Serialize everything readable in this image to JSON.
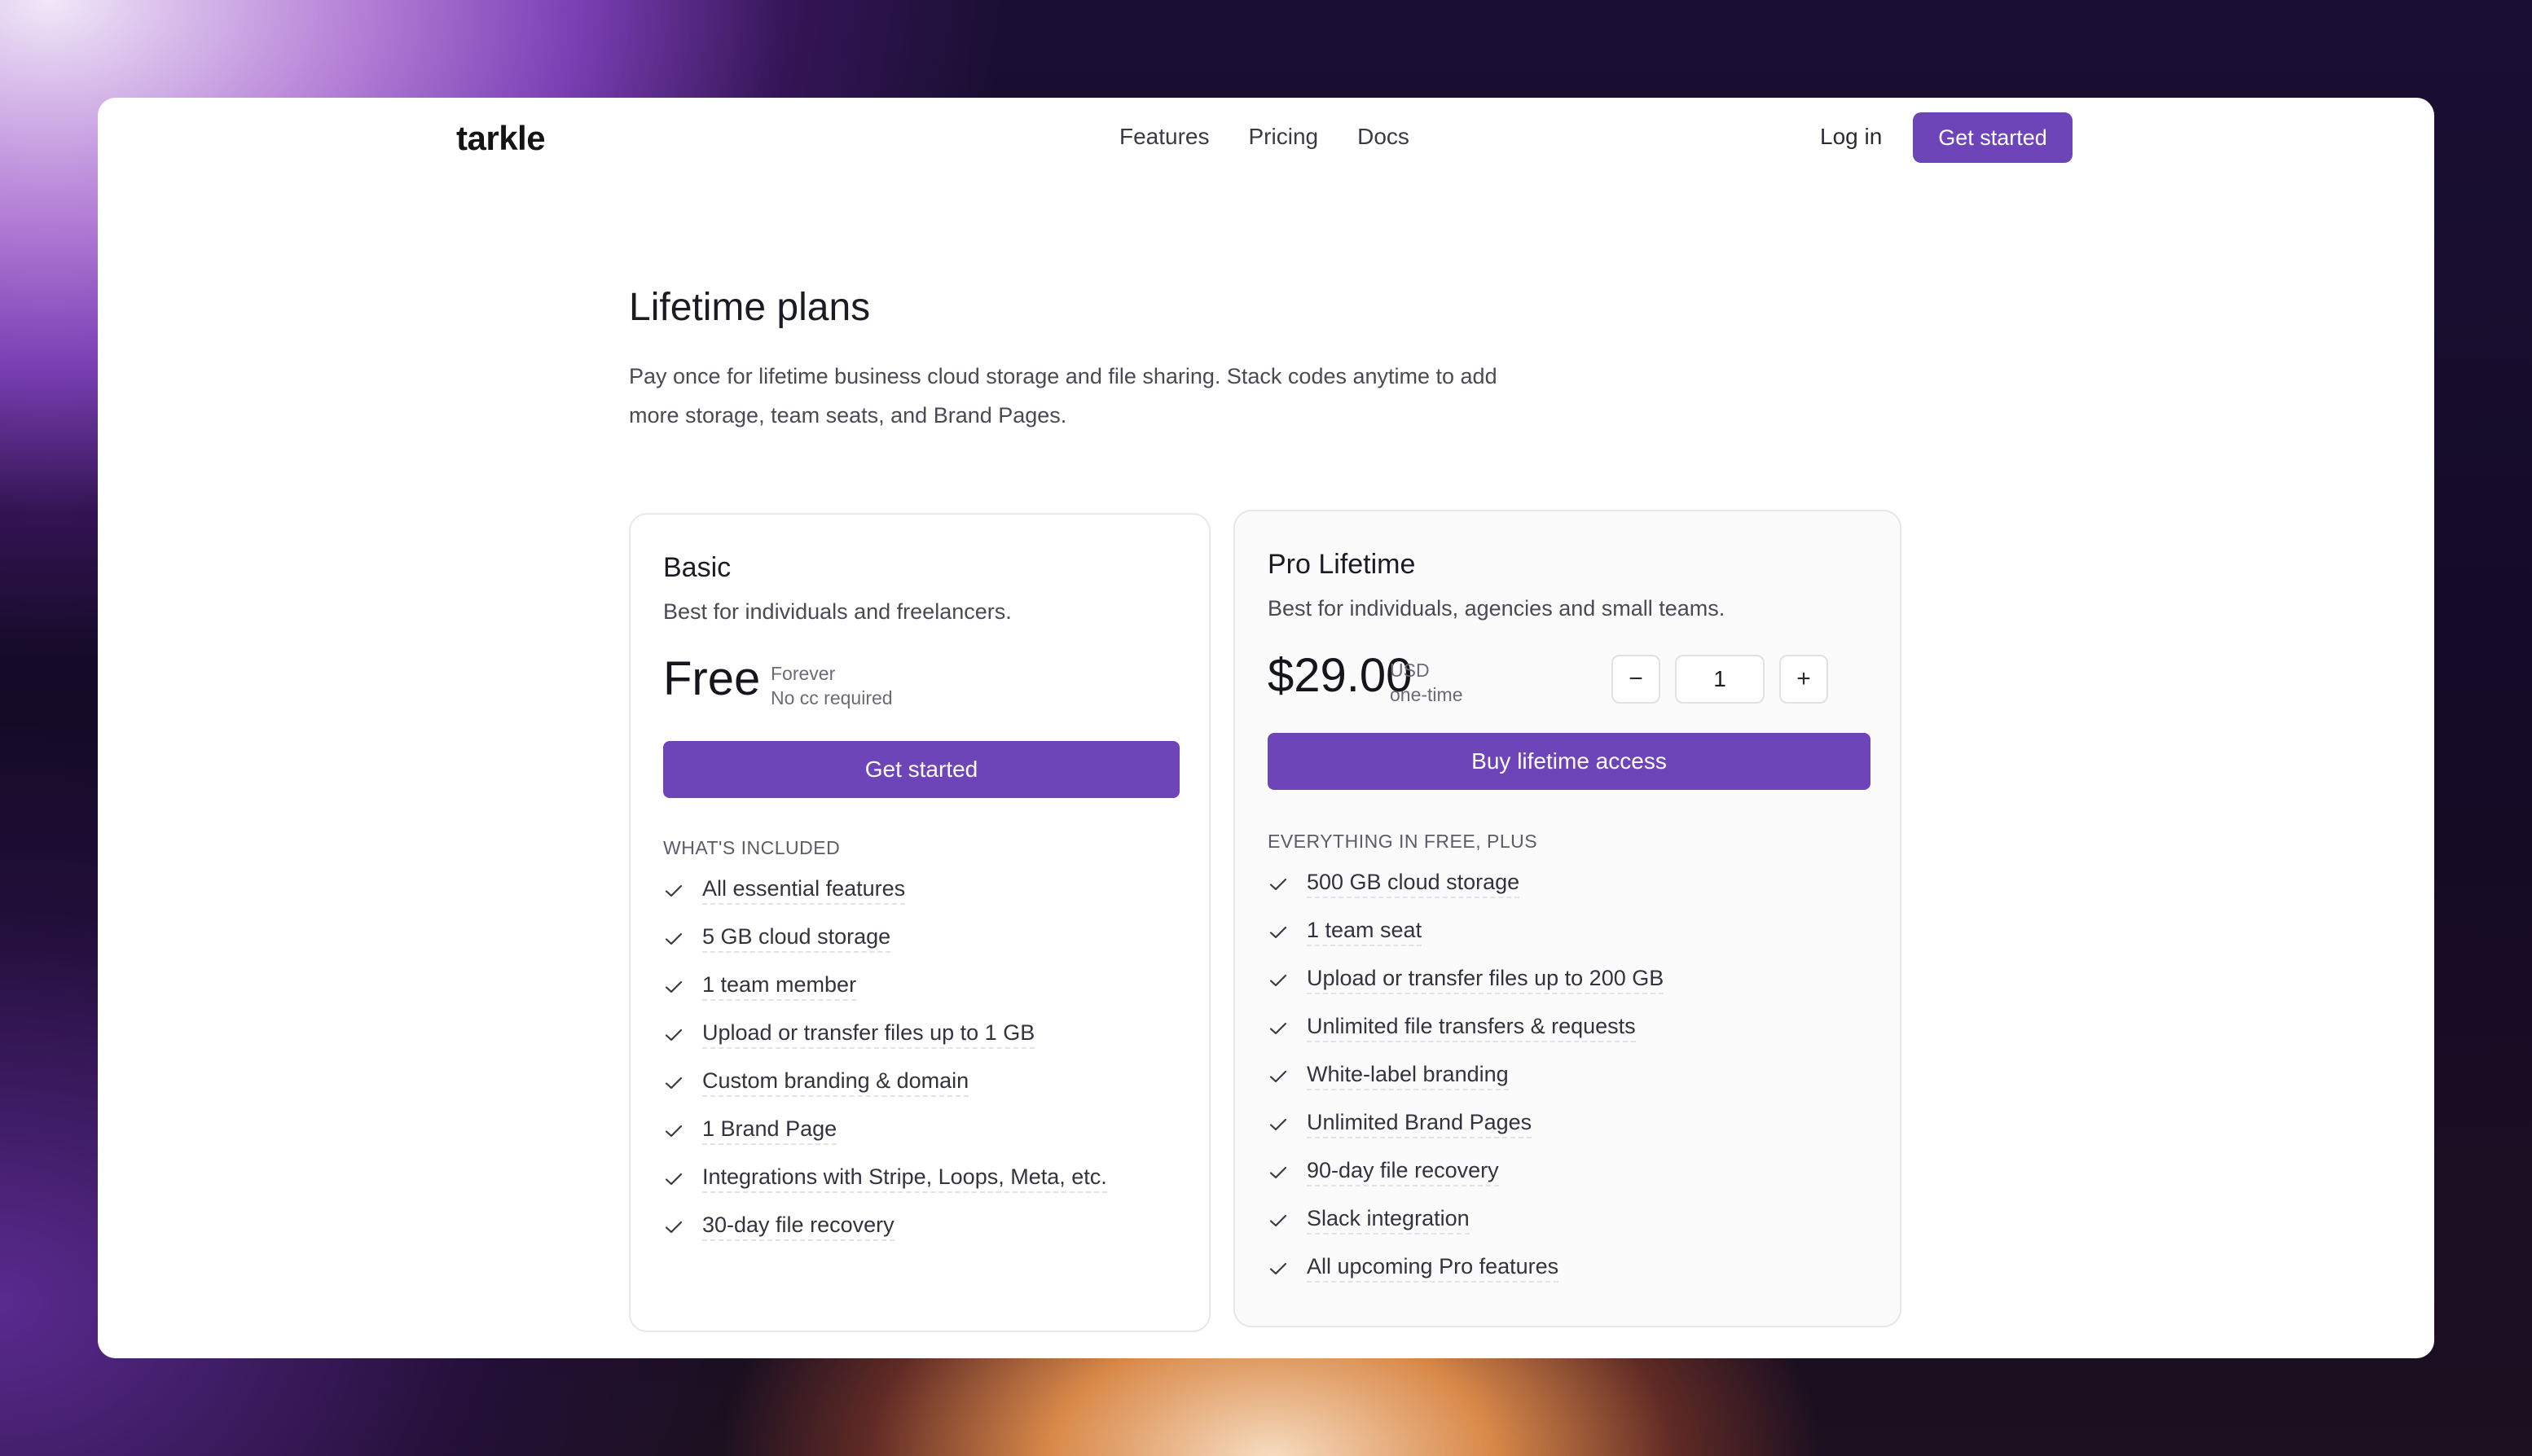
{
  "brand": {
    "name": "tarkle",
    "accent": "#6d45b8"
  },
  "nav": {
    "links": [
      "Features",
      "Pricing",
      "Docs"
    ],
    "login": "Log in",
    "cta": "Get started"
  },
  "hero": {
    "title": "Lifetime plans",
    "description": "Pay once for lifetime business cloud storage and file sharing. Stack codes anytime to add more storage, team seats, and Brand Pages."
  },
  "plans": {
    "basic": {
      "name": "Basic",
      "subtitle": "Best for individuals and freelancers.",
      "price": "Free",
      "meta_1": "Forever",
      "meta_2": "No cc required",
      "cta": "Get started",
      "section_label": "WHAT'S INCLUDED",
      "features": [
        "All essential features",
        "5 GB cloud storage",
        "1 team member",
        "Upload or transfer files up to 1 GB",
        "Custom branding & domain",
        "1 Brand Page",
        "Integrations with Stripe, Loops, Meta, etc.",
        "30-day file recovery"
      ]
    },
    "pro": {
      "name": "Pro Lifetime",
      "subtitle": "Best for individuals, agencies and small teams.",
      "price": "$29.00",
      "meta_1": "USD",
      "meta_2": "one-time",
      "quantity": "1",
      "decrement": "−",
      "increment": "+",
      "cta": "Buy lifetime access",
      "section_label": "EVERYTHING IN FREE, PLUS",
      "features": [
        "500 GB cloud storage",
        "1 team seat",
        "Upload or transfer files up to 200 GB",
        "Unlimited file transfers & requests",
        "White-label branding",
        "Unlimited Brand Pages",
        "90-day file recovery",
        "Slack integration",
        "All upcoming Pro features"
      ]
    }
  },
  "fab": {
    "icon": "plus-icon"
  }
}
